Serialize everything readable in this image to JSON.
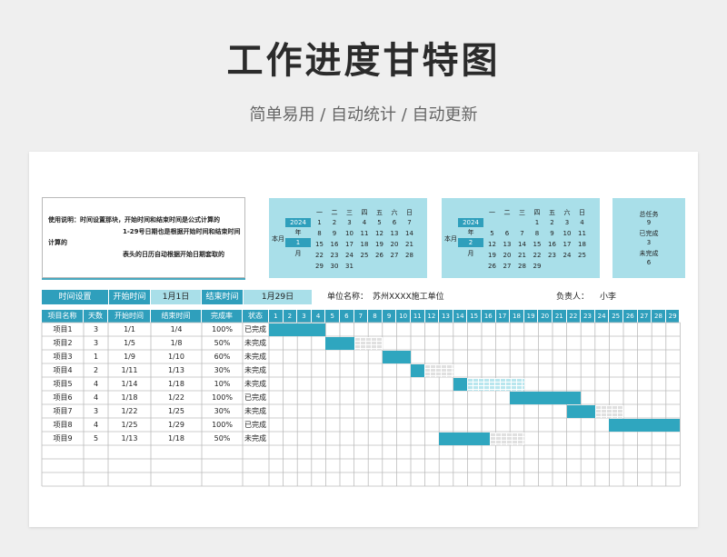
{
  "header": {
    "title": "工作进度甘特图",
    "subtitle": "简单易用 / 自动统计 / 自动更新"
  },
  "note": {
    "line1": "使用说明：时间设置那块，开始时间和结束时间是公式计算的",
    "line2": "1-29号日期也是根据开始时间和结束时间",
    "line3": "计算的",
    "line4": "表头的日历自动根据开始日期套取的"
  },
  "calendars": [
    {
      "side_label": "本月",
      "year": "2024",
      "year_label": "年",
      "month": "1",
      "month_label": "月",
      "weekdays": [
        "一",
        "二",
        "三",
        "四",
        "五",
        "六",
        "日"
      ],
      "rows": [
        [
          "",
          "",
          "",
          "",
          "",
          "",
          ""
        ],
        [
          "1",
          "2",
          "3",
          "4",
          "5",
          "6",
          "7"
        ],
        [
          "8",
          "9",
          "10",
          "11",
          "12",
          "13",
          "14"
        ],
        [
          "15",
          "16",
          "17",
          "18",
          "19",
          "20",
          "21"
        ],
        [
          "22",
          "23",
          "24",
          "25",
          "26",
          "27",
          "28"
        ],
        [
          "29",
          "30",
          "31",
          "",
          "",
          "",
          ""
        ]
      ]
    },
    {
      "side_label": "本月",
      "year": "2024",
      "year_label": "年",
      "month": "2",
      "month_label": "月",
      "weekdays": [
        "一",
        "二",
        "三",
        "四",
        "五",
        "六",
        "日"
      ],
      "rows": [
        [
          "",
          "",
          "",
          "",
          "",
          "",
          ""
        ],
        [
          "",
          "",
          "",
          "1",
          "2",
          "3",
          "4"
        ],
        [
          "5",
          "6",
          "7",
          "8",
          "9",
          "10",
          "11"
        ],
        [
          "12",
          "13",
          "14",
          "15",
          "16",
          "17",
          "18"
        ],
        [
          "19",
          "20",
          "21",
          "22",
          "23",
          "24",
          "25"
        ],
        [
          "26",
          "27",
          "28",
          "29",
          "",
          "",
          ""
        ]
      ]
    }
  ],
  "summary": {
    "total_label": "总任务",
    "total": "9",
    "done_label": "已完成",
    "done": "3",
    "todo_label": "未完成",
    "todo": "6"
  },
  "settings": {
    "time_label": "时间设置",
    "start_label": "开始时间",
    "start_value": "1月1日",
    "end_label": "结束时间",
    "end_value": "1月29日",
    "unit_label": "单位名称：",
    "unit_value": "苏州XXXX施工单位",
    "owner_label": "负责人：",
    "owner_value": "小李"
  },
  "table": {
    "headers": [
      "项目名称",
      "天数",
      "开始时间",
      "结束时间",
      "完成率",
      "状态"
    ],
    "days": [
      "1",
      "2",
      "3",
      "4",
      "5",
      "6",
      "7",
      "8",
      "9",
      "10",
      "11",
      "12",
      "13",
      "14",
      "15",
      "16",
      "17",
      "18",
      "19",
      "20",
      "21",
      "22",
      "23",
      "24",
      "25",
      "26",
      "27",
      "28",
      "29"
    ],
    "rows": [
      {
        "name": "项目1",
        "days": "3",
        "start": "1/1",
        "end": "1/4",
        "rate": "100%",
        "status": "已完成",
        "s": 1,
        "e": 4,
        "done_fraction": 1.0
      },
      {
        "name": "项目2",
        "days": "3",
        "start": "1/5",
        "end": "1/8",
        "rate": "50%",
        "status": "未完成",
        "s": 5,
        "e": 8,
        "done_fraction": 0.5
      },
      {
        "name": "项目3",
        "days": "1",
        "start": "1/9",
        "end": "1/10",
        "rate": "60%",
        "status": "未完成",
        "s": 9,
        "e": 10,
        "done_fraction": 1.0
      },
      {
        "name": "项目4",
        "days": "2",
        "start": "1/11",
        "end": "1/13",
        "rate": "30%",
        "status": "未完成",
        "s": 11,
        "e": 13,
        "done_fraction": 0.33
      },
      {
        "name": "项目5",
        "days": "4",
        "start": "1/14",
        "end": "1/18",
        "rate": "10%",
        "status": "未完成",
        "s": 14,
        "e": 18,
        "done_fraction": 0.2,
        "pale_rest": true
      },
      {
        "name": "项目6",
        "days": "4",
        "start": "1/18",
        "end": "1/22",
        "rate": "100%",
        "status": "已完成",
        "s": 18,
        "e": 22,
        "done_fraction": 1.0
      },
      {
        "name": "项目7",
        "days": "3",
        "start": "1/22",
        "end": "1/25",
        "rate": "30%",
        "status": "未完成",
        "s": 22,
        "e": 25,
        "done_fraction": 0.5
      },
      {
        "name": "项目8",
        "days": "4",
        "start": "1/25",
        "end": "1/29",
        "rate": "100%",
        "status": "已完成",
        "s": 25,
        "e": 29,
        "done_fraction": 1.0
      },
      {
        "name": "项目9",
        "days": "5",
        "start": "1/13",
        "end": "1/18",
        "rate": "50%",
        "status": "未完成",
        "s": 13,
        "e": 18,
        "done_fraction": 0.6
      }
    ],
    "empty_rows": 3
  },
  "colors": {
    "accent": "#2f9fbc",
    "light": "#a9dfe9",
    "bar_done": "#2fa6bf",
    "bar_todo": "#e0e0e0",
    "grid": "#bcbcbc"
  }
}
